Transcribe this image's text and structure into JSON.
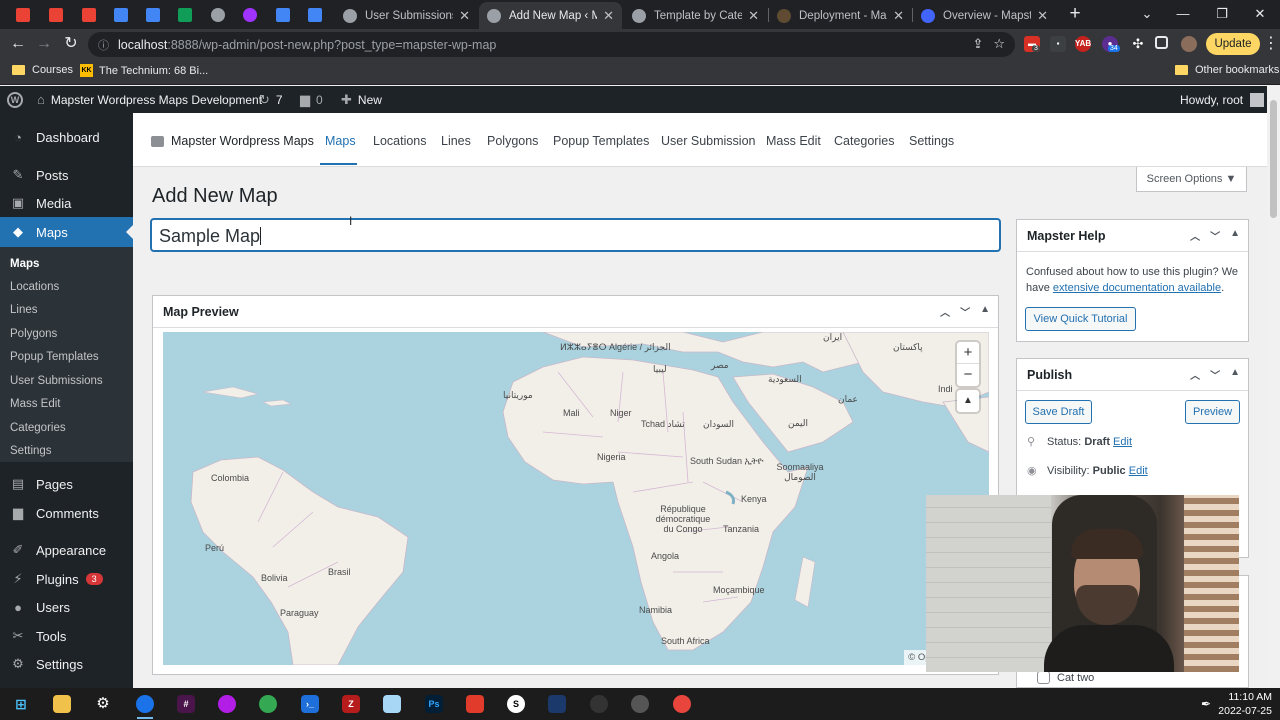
{
  "browser": {
    "tabs": [
      {
        "title": "User Submissions ‹ M",
        "favicon": "globe-icon",
        "active": false
      },
      {
        "title": "Add New Map ‹ Maps",
        "favicon": "globe-icon",
        "active": true
      },
      {
        "title": "Template by Categor",
        "favicon": "globe-icon",
        "active": false
      },
      {
        "title": "Deployment - Maps",
        "favicon": "github-icon",
        "active": false
      },
      {
        "title": "Overview - Mapster",
        "favicon": "mapbox-icon",
        "active": false
      }
    ],
    "url_host": "localhost",
    "url_path": ":8888/wp-admin/post-new.php?post_type=mapster-wp-map",
    "update_label": "Update",
    "extension_badges": [
      "3",
      "34"
    ]
  },
  "bookmarks": [
    {
      "label": "Courses",
      "icon": "folder-icon"
    },
    {
      "label": "The Technium: 68 Bi...",
      "icon": "kk-icon"
    },
    {
      "label": "Other bookmarks",
      "icon": "folder-icon"
    }
  ],
  "adminbar": {
    "site_name": "Mapster Wordpress Maps Development",
    "updates_count": "7",
    "comments_count": "0",
    "new_label": "New",
    "greeting": "Howdy, root"
  },
  "sidebar": {
    "items": [
      {
        "label": "Dashboard",
        "icon": "dashboard-icon"
      },
      {
        "label": "Posts",
        "icon": "pin-icon"
      },
      {
        "label": "Media",
        "icon": "media-icon"
      },
      {
        "label": "Maps",
        "icon": "map-icon"
      },
      {
        "label": "Pages",
        "icon": "page-icon"
      },
      {
        "label": "Comments",
        "icon": "comment-icon"
      },
      {
        "label": "Appearance",
        "icon": "brush-icon"
      },
      {
        "label": "Plugins",
        "icon": "plugin-icon",
        "badge": "3"
      },
      {
        "label": "Users",
        "icon": "user-icon"
      },
      {
        "label": "Tools",
        "icon": "wrench-icon"
      },
      {
        "label": "Settings",
        "icon": "settings-icon"
      }
    ],
    "submenu": [
      "Maps",
      "Locations",
      "Lines",
      "Polygons",
      "Popup Templates",
      "User Submissions",
      "Mass Edit",
      "Categories",
      "Settings"
    ]
  },
  "plugin_nav": {
    "brand": "Mapster Wordpress Maps",
    "links": [
      "Maps",
      "Locations",
      "Lines",
      "Polygons",
      "Popup Templates",
      "User Submission",
      "Mass Edit",
      "Categories",
      "Settings"
    ],
    "active": "Maps"
  },
  "screen_options": "Screen Options ▼",
  "page_title": "Add New Map",
  "title_value": "Sample Map",
  "map_preview": {
    "heading": "Map Preview",
    "attribution": "© OpenStreetMap",
    "labels": [
      "ⵍⵣⵣⴰⵢⴻⵔ Algérie / الجزائر",
      "ليبيا",
      "مصر",
      "ایران",
      "پاکستان",
      "السعودية",
      "موريتانيا",
      "Mali",
      "Niger",
      "Tchad تشاد",
      "السودان",
      "عمان",
      "اليمن",
      "Nigeria",
      "South Sudan ኢትዮ",
      "Soomaaliya الصومال",
      "Kenya",
      "République démocratique du Congo",
      "Tanzania",
      "Angola",
      "Moçambique",
      "Namibia",
      "South Africa",
      "Colombia",
      "Perú",
      "Bolivia",
      "Brasil",
      "Paraguay",
      "Indi"
    ]
  },
  "help_box": {
    "heading": "Mapster Help",
    "text": "Confused about how to use this plugin? We have",
    "link": "extensive documentation available",
    "button": "View Quick Tutorial"
  },
  "publish_box": {
    "heading": "Publish",
    "save_draft": "Save Draft",
    "preview": "Preview",
    "status_label": "Status:",
    "status_value": "Draft",
    "visibility_label": "Visibility:",
    "visibility_value": "Public",
    "edit_label": "Edit"
  },
  "category_item": "Cat two",
  "taskbar": {
    "time": "11:10 AM",
    "date": "2022-07-25"
  },
  "colors": {
    "wp_blue": "#2271b1",
    "admin_dark": "#1d2327",
    "map_water": "#aad3df",
    "map_land": "#f2efe9"
  }
}
